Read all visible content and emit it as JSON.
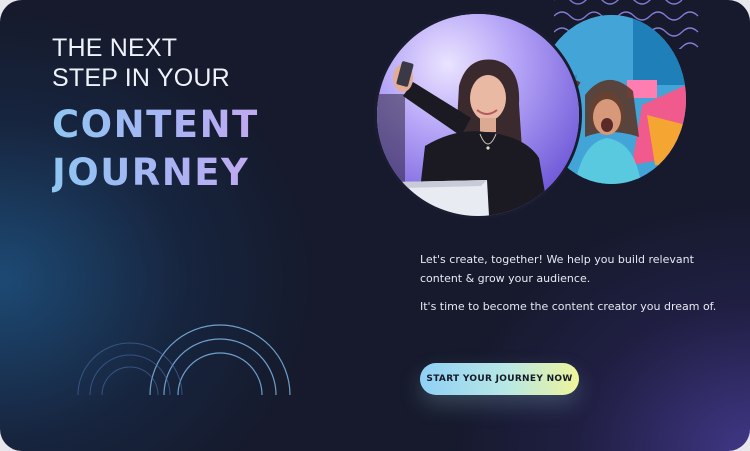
{
  "hero": {
    "headline_line1": "THE NEXT",
    "headline_line2": "STEP IN YOUR",
    "headline_line3": "CONTENT",
    "headline_line4": "JOURNEY"
  },
  "body": {
    "paragraph1": "Let's create, together! We help you build relevant content & grow your audience.",
    "paragraph2": "It's time to become the content creator you dream of."
  },
  "cta": {
    "label": "START YOUR JOURNEY NOW"
  },
  "images": {
    "main_photo": "woman-taking-selfie-photo",
    "secondary_photo": "woman-laughing-colorful-wall-photo"
  },
  "colors": {
    "background": "#161a2c",
    "headline_gradient_start": "#8fc6f2",
    "headline_gradient_end": "#c1a9f0",
    "button_gradient_start": "#8fd0f6",
    "button_gradient_end": "#eef49a"
  }
}
